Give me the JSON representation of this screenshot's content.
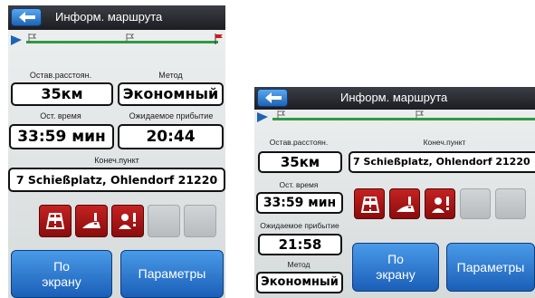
{
  "portrait": {
    "title": "Информ. маршрута",
    "remaining_distance": {
      "label": "Остав.расстоян.",
      "value": "35км"
    },
    "method": {
      "label": "Метод",
      "value": "Экономный"
    },
    "remaining_time": {
      "label": "Ост. время",
      "value": "33:59 мин"
    },
    "eta": {
      "label": "Ожидаемое прибытие",
      "value": "20:44"
    },
    "destination": {
      "label": "Конеч.пункт",
      "value": "7 Schießplatz, Ohlendorf 21220"
    },
    "buttons": {
      "by_screen": "По экрану",
      "params": "Параметры"
    }
  },
  "landscape": {
    "title": "Информ. маршрута",
    "remaining_distance": {
      "label": "Остав.расстоян.",
      "value": "35км"
    },
    "remaining_time": {
      "label": "Ост. время",
      "value": "33:59 мин"
    },
    "eta": {
      "label": "Ожидаемое прибытие",
      "value": "21:58"
    },
    "method": {
      "label": "Метод",
      "value": "Экономный"
    },
    "destination": {
      "label": "Конеч.пункт",
      "value": "7 Schießplatz, Ohlendorf 21220"
    },
    "buttons": {
      "by_screen": "По экрану",
      "params": "Параметры"
    }
  },
  "warning_icons": [
    "toll-road-icon",
    "unpaved-road-icon",
    "permit-required-icon",
    "empty-slot",
    "empty-slot"
  ],
  "colors": {
    "accent": "#1f63b5",
    "warning": "#a81414",
    "route": "#2f9a44"
  }
}
